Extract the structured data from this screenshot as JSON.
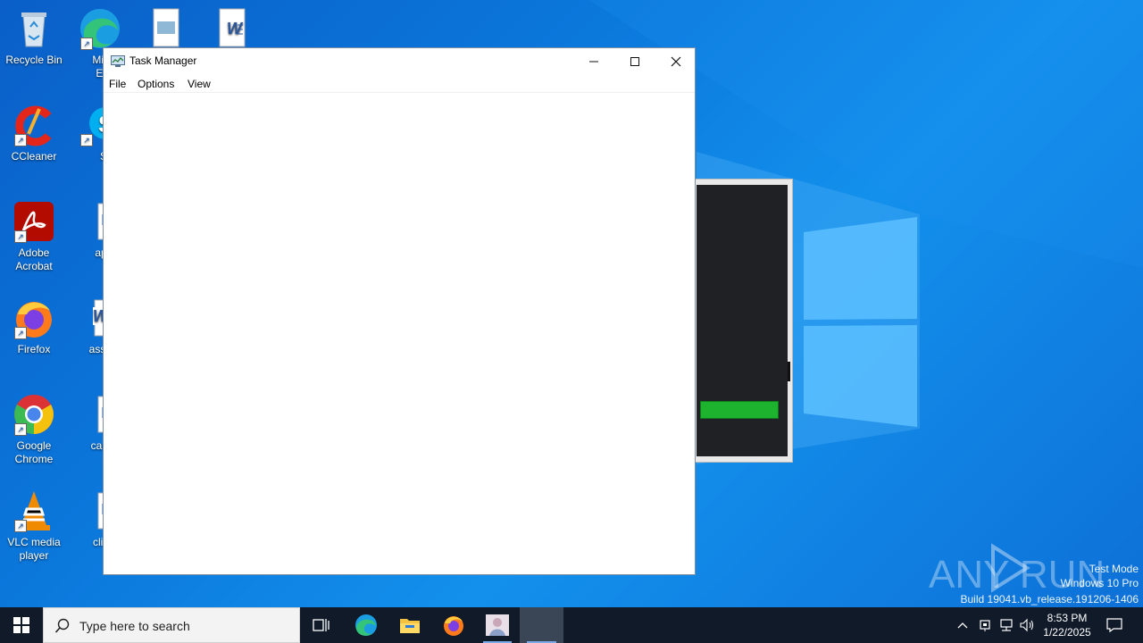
{
  "desktop": {
    "icons": [
      {
        "label": "Recycle Bin"
      },
      {
        "label": "Micro Edg"
      },
      {
        "label": "CCleaner"
      },
      {
        "label": "Sky"
      },
      {
        "label": "Adobe Acrobat"
      },
      {
        "label": "applic"
      },
      {
        "label": "Firefox"
      },
      {
        "label": "associa"
      },
      {
        "label": "Google Chrome"
      },
      {
        "label": "careerb"
      },
      {
        "label": "VLC media player"
      },
      {
        "label": "clientm"
      }
    ]
  },
  "task_manager": {
    "title": "Task Manager",
    "menu": {
      "file": "File",
      "options": "Options",
      "view": "View"
    }
  },
  "watermark": {
    "brand": "ANY RUN",
    "line1": "Test Mode",
    "line2": "Windows 10 Pro",
    "line3": "Build 19041.vb_release.191206-1406"
  },
  "taskbar": {
    "search_placeholder": "Type here to search",
    "time": "8:53 PM",
    "date": "1/22/2025"
  },
  "colors": {
    "desktop_blue": "#0b78dc",
    "taskbar": "#101a28",
    "progress_green": "#1db32f"
  }
}
